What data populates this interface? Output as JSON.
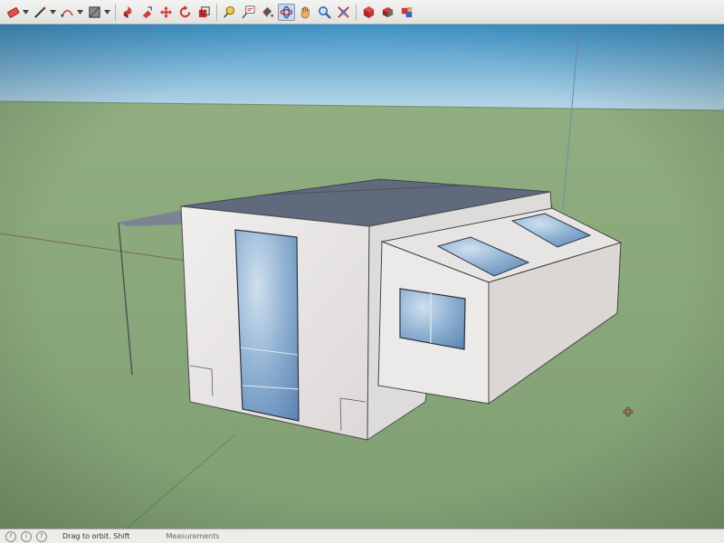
{
  "toolbar": {
    "tools": [
      {
        "name": "eraser-tool",
        "dropdown": true
      },
      {
        "name": "pencil-line-tool",
        "dropdown": true
      },
      {
        "name": "arc-tool",
        "dropdown": true
      },
      {
        "name": "shape-tool",
        "dropdown": true
      },
      {
        "name": "push-pull-tool",
        "dropdown": false
      },
      {
        "name": "follow-me-tool",
        "dropdown": false
      },
      {
        "name": "move-tool",
        "dropdown": false
      },
      {
        "name": "rotate-tool",
        "dropdown": false
      },
      {
        "name": "scale-tool",
        "dropdown": false
      },
      {
        "name": "tape-measure-tool",
        "dropdown": false
      },
      {
        "name": "text-tool",
        "dropdown": false
      },
      {
        "name": "paint-bucket-tool",
        "dropdown": false
      },
      {
        "name": "orbit-tool",
        "dropdown": false,
        "active": true
      },
      {
        "name": "pan-tool",
        "dropdown": false
      },
      {
        "name": "zoom-tool",
        "dropdown": false
      },
      {
        "name": "zoom-extents-tool",
        "dropdown": false
      },
      {
        "name": "3d-warehouse-tool",
        "dropdown": false
      },
      {
        "name": "share-model-tool",
        "dropdown": false
      },
      {
        "name": "extension-warehouse-tool",
        "dropdown": false
      }
    ]
  },
  "colors": {
    "sky_top": "#3f95c9",
    "sky_bottom": "#b9d7e7",
    "ground": "#86a67a",
    "wall_light": "#ebe9e8",
    "wall_shade": "#dedcda",
    "roof": "#5d6779",
    "glass": "#9ab8d6",
    "accent_active": "#c9d7e8"
  },
  "status": {
    "text": "Drag to orbit. Shift",
    "measurements_label": "Measurements"
  }
}
